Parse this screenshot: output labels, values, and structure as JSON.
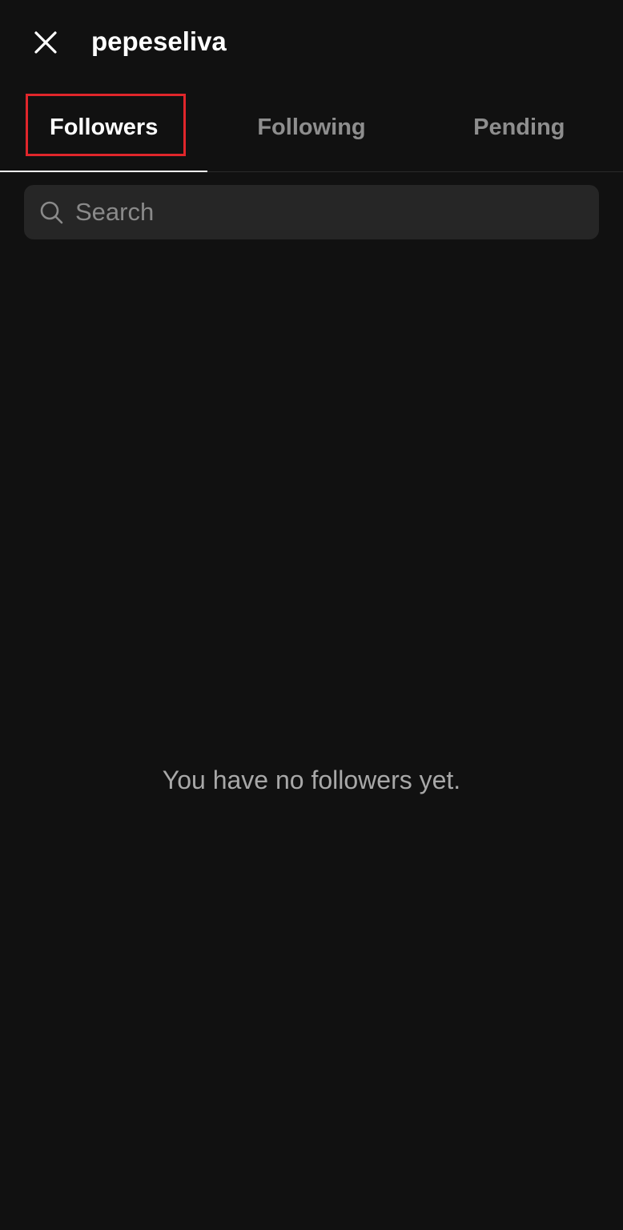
{
  "header": {
    "title": "pepeseliva",
    "close_icon": "close-icon"
  },
  "tabs": [
    {
      "label": "Followers",
      "active": true
    },
    {
      "label": "Following",
      "active": false
    },
    {
      "label": "Pending",
      "active": false
    }
  ],
  "search": {
    "value": "",
    "placeholder": "Search",
    "icon": "search-icon"
  },
  "empty_state": {
    "message": "You have no followers yet."
  },
  "colors": {
    "background": "#111111",
    "search_background": "#262626",
    "active_tab": "#ffffff",
    "inactive_tab": "#8e8e8e",
    "highlight": "#e0262b"
  }
}
